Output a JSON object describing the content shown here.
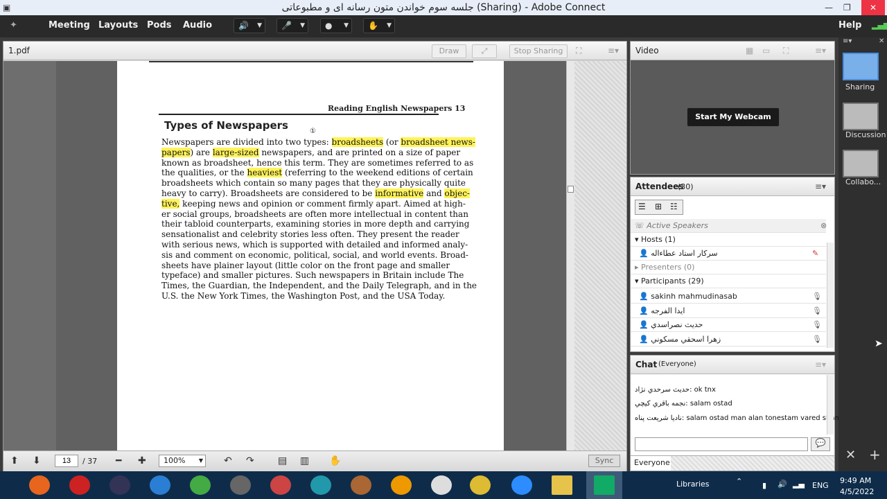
{
  "window": {
    "title": "جلسه سوم خواندن متون رسانه ای و مطبوعاتی (Sharing) - Adobe Connect"
  },
  "menu": {
    "items": [
      "Meeting",
      "Layouts",
      "Pods",
      "Audio"
    ],
    "help": "Help"
  },
  "share_pod": {
    "title": "1.pdf",
    "draw": "Draw",
    "stop_sharing": "Stop Sharing",
    "page_current": "13",
    "page_total": "/ 37",
    "zoom": "100%",
    "sync": "Sync"
  },
  "document": {
    "header": "Reading English Newspapers  13",
    "heading": "Types of Newspapers",
    "lines": [
      [
        "Newspapers are divided into two types: ",
        {
          "h": "broadsheets"
        },
        " (or ",
        {
          "h": "broadsheet news-"
        }
      ],
      [
        {
          "h": "papers"
        },
        ") are ",
        {
          "h": "large-sized"
        },
        " newspapers, and are printed on a size of paper"
      ],
      [
        "known as broadsheet, hence this term. They are sometimes referred to as"
      ],
      [
        "the qualities, or the ",
        {
          "h": "heaviest"
        },
        " (referring to the weekend editions of certain"
      ],
      [
        "broadsheets which contain so many pages that they are physically quite"
      ],
      [
        "heavy to carry). Broadsheets are considered to be ",
        {
          "h": "informative"
        },
        " and ",
        {
          "h": "objec-"
        }
      ],
      [
        {
          "h": "tive,"
        },
        " keeping news and opinion or comment firmly apart. Aimed at high-"
      ],
      [
        "er social groups, broadsheets are often more intellectual in content than"
      ],
      [
        "their tabloid counterparts, examining stories in more depth and carrying"
      ],
      [
        "sensationalist and celebrity stories less often. They present the reader"
      ],
      [
        "with serious news, which is supported with detailed and informed analy-"
      ],
      [
        "sis and comment on economic, political, social, and world events. Broad-"
      ],
      [
        "sheets have plainer layout (little color on the front page and smaller"
      ],
      [
        "typeface) and smaller pictures. Such newspapers in Britain include The"
      ],
      [
        "Times, the Guardian, the Independent, and the Daily Telegraph, and in the"
      ],
      [
        "U.S. the New York Times, the Washington Post, and the USA Today."
      ]
    ]
  },
  "video_pod": {
    "title": "Video",
    "webcam_button": "Start My Webcam"
  },
  "attendees": {
    "title": "Attendees",
    "count": "(30)",
    "active_speakers": "Active Speakers",
    "hosts": "Hosts (1)",
    "host_name": "سرکار استاد عطاءاله",
    "presenters": "Presenters (0)",
    "participants": "Participants (29)",
    "names": [
      "sakinh mahmudinasab",
      "ایدا الفرجه",
      "حدیث نصراسدي",
      "زهرا اسحقي مسكوني"
    ]
  },
  "chat": {
    "title": "Chat",
    "scope": "(Everyone)",
    "messages": [
      "حدیث سرحدي نژاد: ok tnx",
      "نجمه باقري كيچي: salam ostad",
      "نادیا شریعت پناه: salam ostad man alan tonestam vared sham"
    ],
    "tab": "Everyone"
  },
  "layouts": [
    "Sharing",
    "Discussion",
    "Collabo..."
  ],
  "taskbar": {
    "libraries": "Libraries",
    "lang": "ENG",
    "time": "9:49 AM",
    "date": "4/5/2022"
  }
}
